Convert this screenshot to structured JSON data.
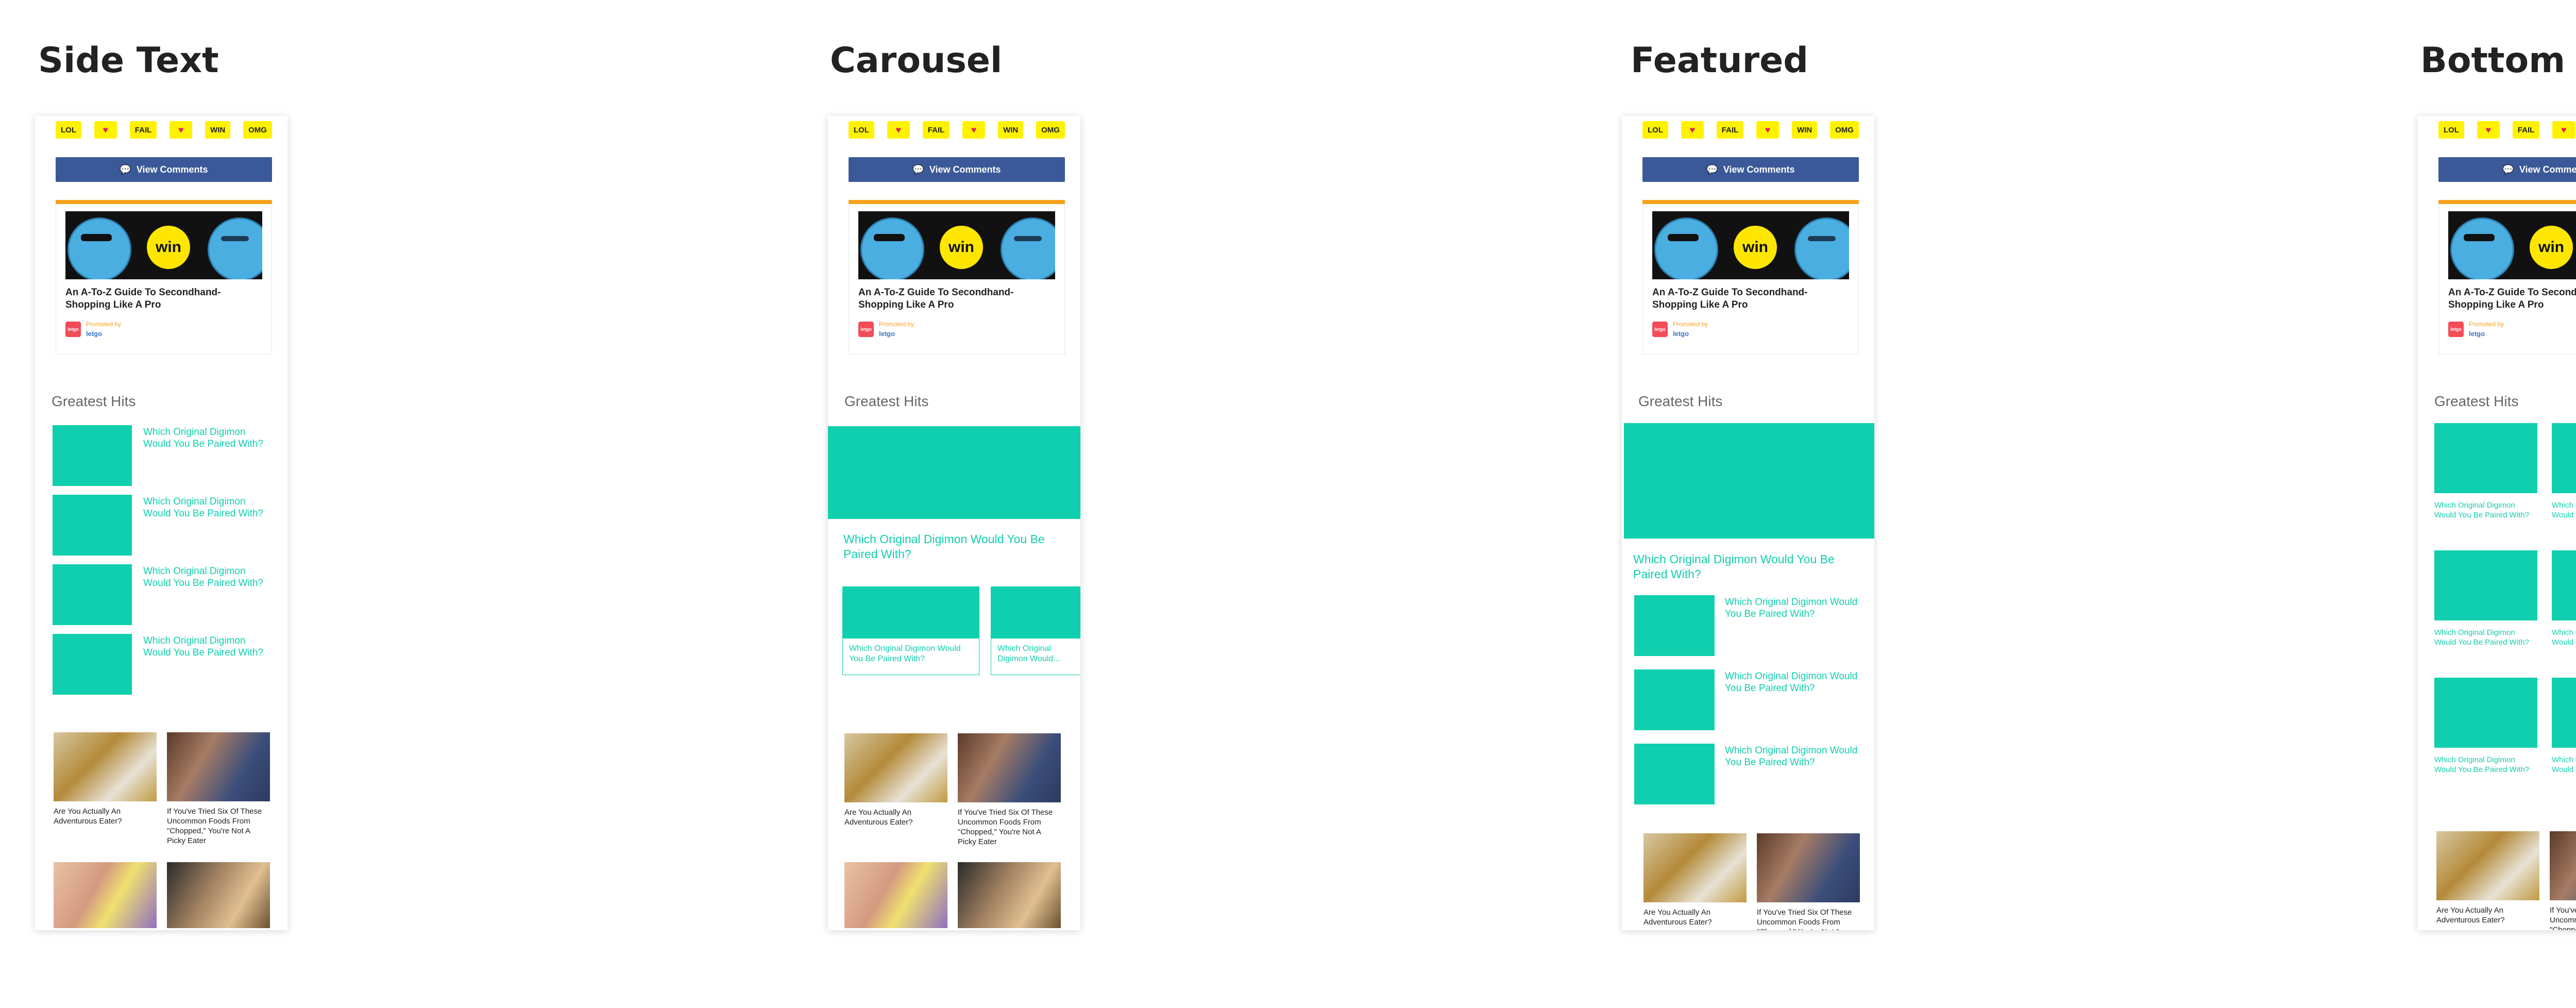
{
  "columns": [
    {
      "title": "Side Text"
    },
    {
      "title": "Carousel"
    },
    {
      "title": "Featured"
    },
    {
      "title": "Bottom Text"
    }
  ],
  "reactions": [
    "LOL",
    "♥",
    "FAIL",
    "♥",
    "WIN",
    "OMG"
  ],
  "comments_button": {
    "label": "View Comments",
    "icon": "speech-bubble-icon"
  },
  "promo": {
    "title": "An A-To-Z Guide To Secondhand-Shopping Like A Pro",
    "promoted_by": "Promoted by",
    "brand": "letgo",
    "logo_text": "letgo",
    "badge": "win"
  },
  "section_title": "Greatest Hits",
  "item_title": "Which Original Digimon Would You Be Paired With?",
  "carousel_partial": "Which Original Digimon Would...",
  "more": [
    {
      "title": "Are You Actually An Adventurous Eater?"
    },
    {
      "title": "If You've Tried Six Of These Uncommon Foods From \"Chopped,\" You're Not A Picky Eater"
    }
  ],
  "colors": {
    "teal": "#10cfae",
    "reaction_yellow": "#fff200",
    "facebook_blue": "#3b5998",
    "accent_orange": "#f6a21e",
    "heart_red": "#e0245e"
  }
}
